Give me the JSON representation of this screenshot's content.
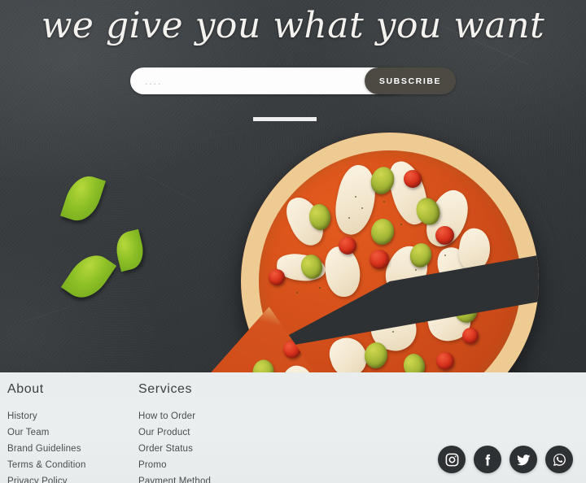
{
  "hero": {
    "headline": "we give you what you want",
    "subscribe": {
      "input_value": "",
      "input_placeholder": "....",
      "button_label": "SUBSCRIBE"
    }
  },
  "decor": {
    "divider": "",
    "leaves": [
      "basil-leaf",
      "basil-leaf",
      "basil-leaf"
    ],
    "food_image": "pizza-with-olives-and-tomatoes"
  },
  "footer": {
    "columns": [
      {
        "heading": "About",
        "links": [
          "History",
          "Our Team",
          "Brand Guidelines",
          "Terms & Condition",
          "Privacy Policy"
        ]
      },
      {
        "heading": "Services",
        "links": [
          "How to Order",
          "Our Product",
          "Order Status",
          "Promo",
          "Payment Method"
        ]
      }
    ],
    "social": [
      {
        "name": "instagram",
        "label": "Instagram"
      },
      {
        "name": "facebook",
        "label": "Facebook"
      },
      {
        "name": "twitter",
        "label": "Twitter"
      },
      {
        "name": "whatsapp",
        "label": "WhatsApp"
      }
    ]
  },
  "colors": {
    "background_dark": "#33373a",
    "footer_bg": "#e9eded",
    "button_bg": "#4d4a43",
    "social_bg": "#2e3133",
    "text_light": "#f4f2ee",
    "text_dark": "#4a4d50"
  }
}
